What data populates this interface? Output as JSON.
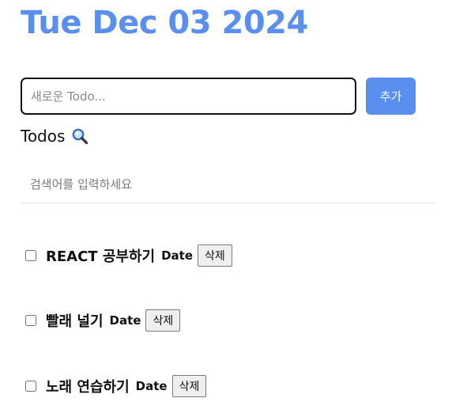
{
  "header": {
    "date": "Tue Dec 03 2024"
  },
  "editor": {
    "placeholder": "새로운 Todo...",
    "value": "",
    "add_label": "추가"
  },
  "list": {
    "heading": "Todos",
    "search_icon": "magnifier-icon",
    "search_placeholder": "검색어를 입력하세요",
    "items": [
      {
        "text": "REACT 공부하기",
        "done": false,
        "date_label": "Date",
        "delete_label": "삭제"
      },
      {
        "text": "빨래 널기",
        "done": false,
        "date_label": "Date",
        "delete_label": "삭제"
      },
      {
        "text": "노래 연습하기",
        "done": false,
        "date_label": "Date",
        "delete_label": "삭제"
      }
    ]
  },
  "colors": {
    "accent": "#5a8ff0",
    "text": "#111111",
    "divider": "#e3e3e3"
  }
}
